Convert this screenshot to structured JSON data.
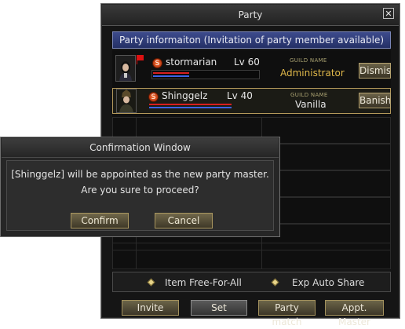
{
  "party": {
    "title": "Party",
    "close_glyph": "✕",
    "info_banner": "Party informaiton (Invitation of party member available)",
    "members": [
      {
        "name": "stormarian",
        "level": "Lv 60",
        "guild_label": "GUILD NAME",
        "guild_name": "Administrator",
        "guild_color": "#e0b84a",
        "action": "Dismiss",
        "is_leader": true,
        "hp_fraction": 0.95,
        "mp_fraction": 0.95
      },
      {
        "name": "Shinggelz",
        "level": "Lv 40",
        "guild_label": "GUILD NAME",
        "guild_name": "Vanilla",
        "guild_color": "#e6e6e6",
        "action": "Banish",
        "is_leader": false,
        "hp_fraction": 0.75,
        "mp_fraction": 0.75
      }
    ],
    "options": {
      "item": "Item Free-For-All",
      "exp": "Exp Auto Share"
    },
    "buttons": {
      "invite": "Invite",
      "set": "Set",
      "party_match": "Party match",
      "appt_master": "Appt. Master"
    },
    "colors": {
      "hp": "#d81f1f",
      "mp": "#3d63e6",
      "accent_gold": "#b5a26f"
    }
  },
  "confirm": {
    "title": "Confirmation Window",
    "line1": "[Shinggelz] will be appointed as the new party master.",
    "line2": "Are you sure to proceed?",
    "confirm_label": "Confirm",
    "cancel_label": "Cancel"
  }
}
